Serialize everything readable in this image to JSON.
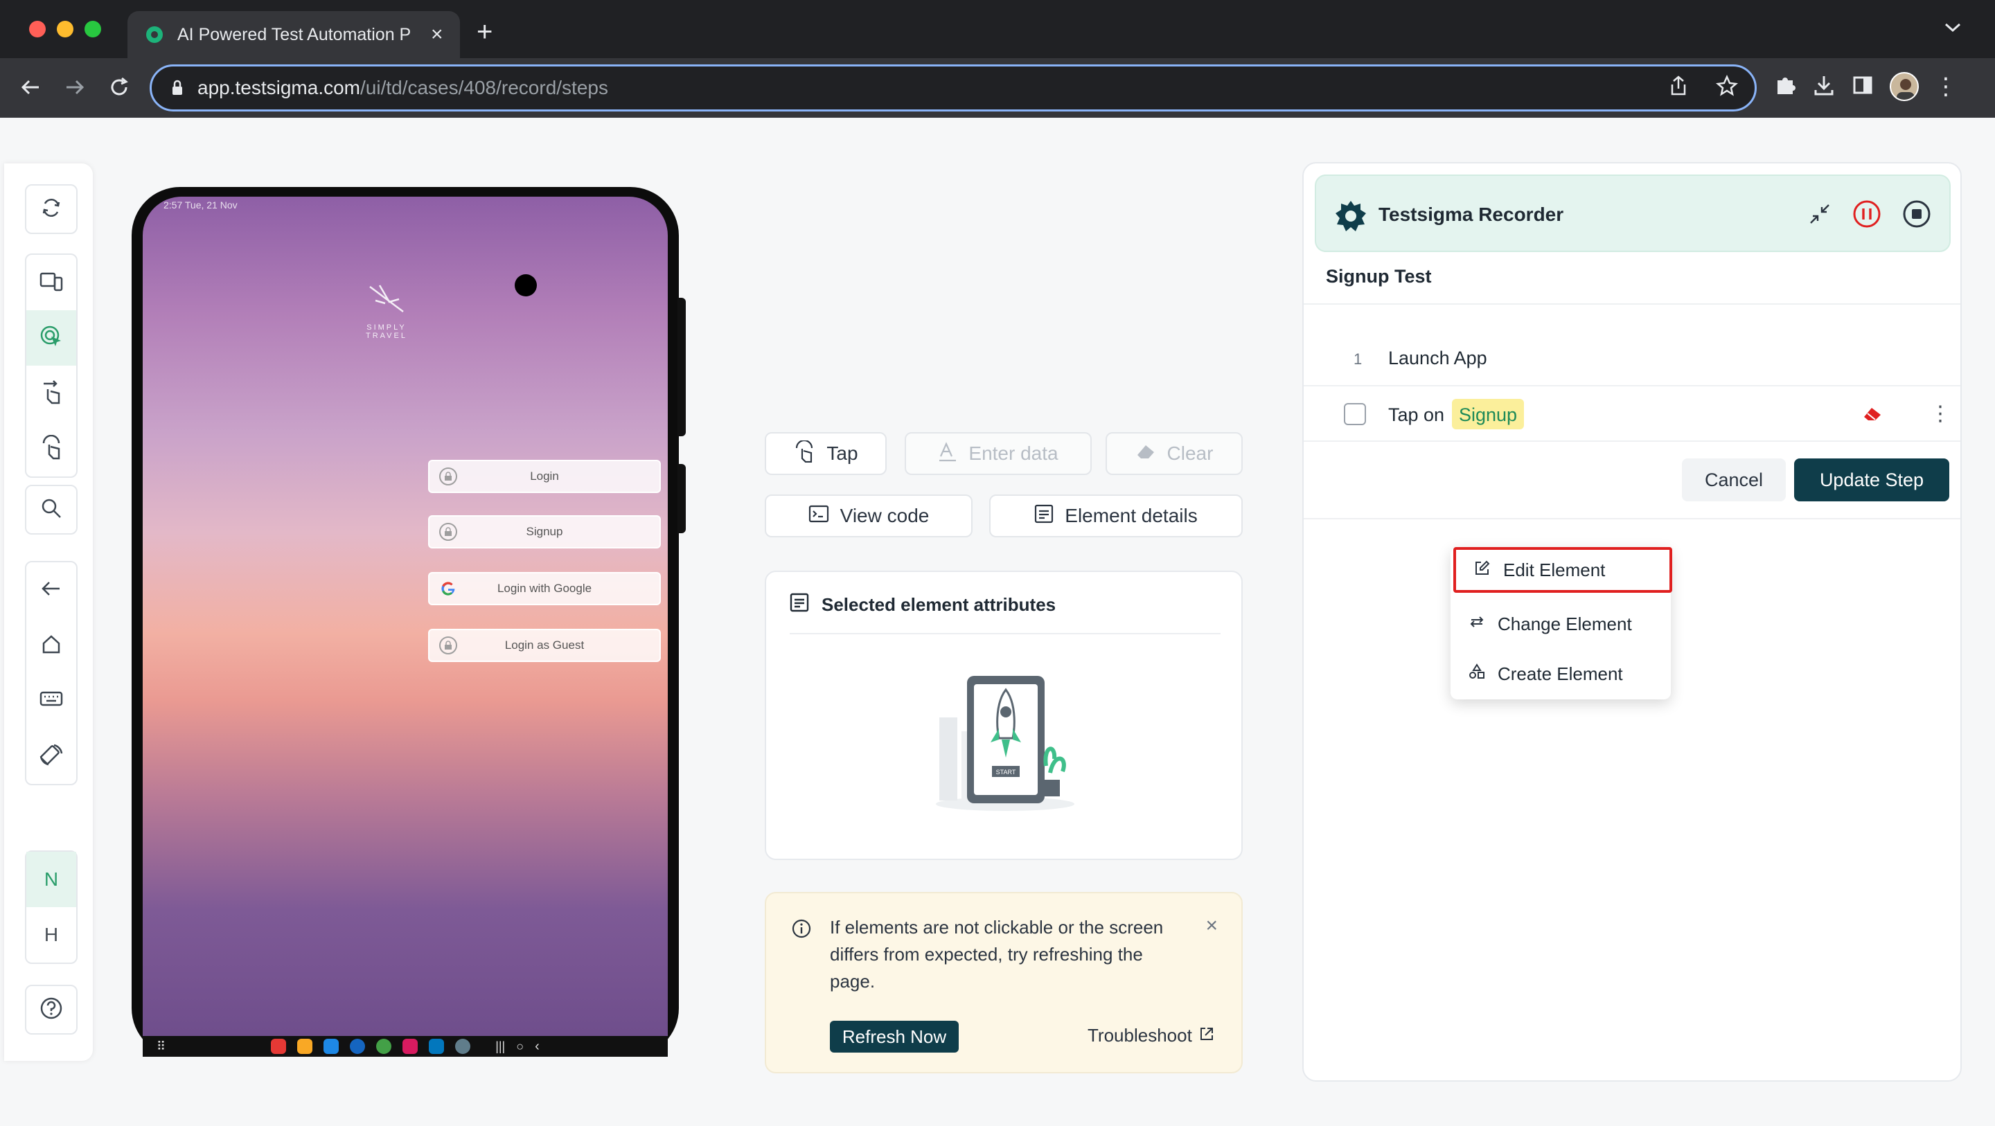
{
  "browser": {
    "tab_title": "AI Powered Test Automation P",
    "url_host": "app.testsigma.com",
    "url_path": "/ui/td/cases/408/record/steps"
  },
  "rail": {
    "letters": [
      "N",
      "H"
    ]
  },
  "phone": {
    "status_left": "2:57  Tue, 21 Nov",
    "app_name": "SIMPLY TRAVEL",
    "buttons": [
      {
        "label": "Login"
      },
      {
        "label": "Signup"
      },
      {
        "label": "Login with Google"
      },
      {
        "label": "Login as Guest"
      }
    ]
  },
  "actions": {
    "tap": "Tap",
    "enter_data": "Enter data",
    "clear": "Clear",
    "view_code": "View code",
    "element_details": "Element details"
  },
  "attributes": {
    "title": "Selected element attributes",
    "illustration_label": "START"
  },
  "notice": {
    "text": "If elements are not clickable or the screen differs from expected, try refreshing the page.",
    "refresh": "Refresh Now",
    "troubleshoot": "Troubleshoot"
  },
  "recorder": {
    "title": "Testsigma Recorder",
    "test_name": "Signup Test",
    "steps": [
      {
        "num": "1",
        "text": "Launch App"
      }
    ],
    "editing_step": {
      "prefix": "Tap on",
      "element": "Signup"
    },
    "cancel": "Cancel",
    "update": "Update Step",
    "menu": [
      {
        "label": "Edit Element"
      },
      {
        "label": "Change Element"
      },
      {
        "label": "Create Element"
      }
    ]
  },
  "colors": {
    "brand_dark": "#0f3d4a",
    "brand_green": "#2a9d6a",
    "highlight_yellow": "#fbef9b",
    "stop_red": "#e02020"
  }
}
